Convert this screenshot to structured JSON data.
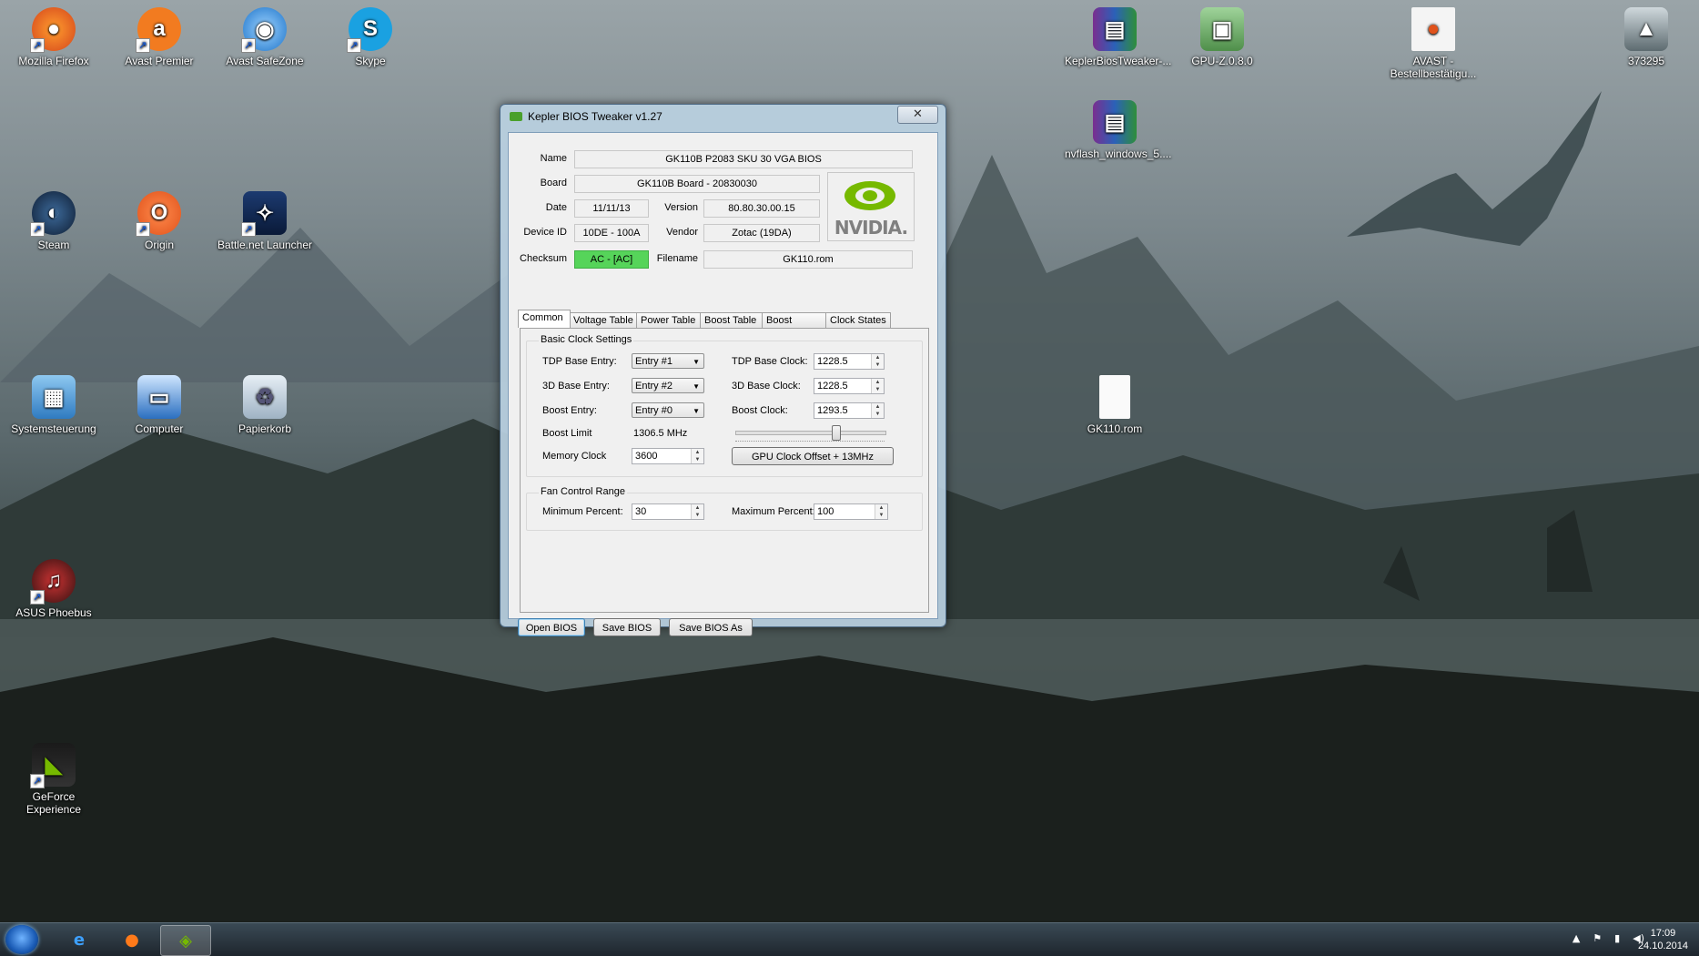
{
  "desktop": {
    "icons": [
      {
        "label": "Mozilla Firefox"
      },
      {
        "label": "Avast Premier"
      },
      {
        "label": "Avast SafeZone"
      },
      {
        "label": "Skype"
      },
      {
        "label": "Steam"
      },
      {
        "label": "Origin"
      },
      {
        "label": "Battle.net Launcher"
      },
      {
        "label": "Systemsteuerung"
      },
      {
        "label": "Computer"
      },
      {
        "label": "Papierkorb"
      },
      {
        "label": "ASUS Phoebus"
      },
      {
        "label": "GeForce Experience"
      },
      {
        "label": "KeplerBiosTweaker-..."
      },
      {
        "label": "GPU-Z.0.8.0"
      },
      {
        "label": "AVAST - Bestellbestätigu..."
      },
      {
        "label": "373295"
      },
      {
        "label": "nvflash_windows_5...."
      },
      {
        "label": "GK110.rom"
      }
    ]
  },
  "window": {
    "title": "Kepler BIOS Tweaker v1.27",
    "close_glyph": "✕",
    "info": {
      "name_label": "Name",
      "name_value": "GK110B P2083 SKU 30 VGA BIOS",
      "board_label": "Board",
      "board_value": "GK110B Board - 20830030",
      "date_label": "Date",
      "date_value": "11/11/13",
      "version_label": "Version",
      "version_value": "80.80.30.00.15",
      "device_label": "Device ID",
      "device_value": "10DE - 100A",
      "vendor_label": "Vendor",
      "vendor_value": "Zotac (19DA)",
      "checksum_label": "Checksum",
      "checksum_value": "AC - [AC]",
      "filename_label": "Filename",
      "filename_value": "GK110.rom",
      "logo_text": "NVIDIA."
    },
    "tabs": [
      "Common",
      "Voltage Table",
      "Power Table",
      "Boost Table",
      "Boost States",
      "Clock States"
    ],
    "common": {
      "basic_title": "Basic Clock Settings",
      "tdp_base_entry_label": "TDP Base Entry:",
      "tdp_base_entry_value": "Entry #1",
      "base3d_entry_label": "3D Base Entry:",
      "base3d_entry_value": "Entry #2",
      "boost_entry_label": "Boost Entry:",
      "boost_entry_value": "Entry #0",
      "boost_limit_label": "Boost Limit",
      "boost_limit_value": "1306.5 MHz",
      "memory_clock_label": "Memory Clock",
      "memory_clock_value": "3600",
      "tdp_base_clock_label": "TDP Base Clock:",
      "tdp_base_clock_value": "1228.5",
      "base3d_clock_label": "3D Base Clock:",
      "base3d_clock_value": "1228.5",
      "boost_clock_label": "Boost Clock:",
      "boost_clock_value": "1293.5",
      "offset_slider_fraction": 0.67,
      "gpu_offset_button": "GPU Clock Offset + 13MHz",
      "fan_title": "Fan Control Range",
      "min_percent_label": "Minimum Percent:",
      "min_percent_value": "30",
      "max_percent_label": "Maximum Percent:",
      "max_percent_value": "100"
    },
    "buttons": {
      "open": "Open BIOS",
      "save": "Save BIOS",
      "save_as": "Save BIOS As"
    }
  },
  "taskbar": {
    "clock_time": "17:09",
    "clock_date": "24.10.2014"
  },
  "colors": {
    "checksum_ok": "#56d45a",
    "nvidia_green": "#76b900"
  }
}
